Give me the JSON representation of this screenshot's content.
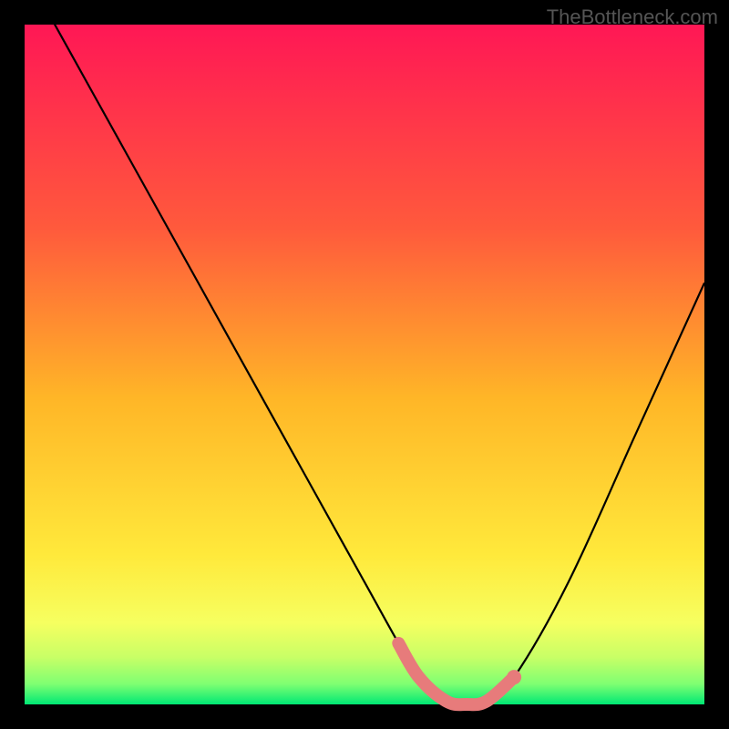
{
  "watermark": "TheBottleneck.com",
  "chart_data": {
    "type": "line",
    "title": "",
    "xlabel": "",
    "ylabel": "",
    "xlim": [
      0,
      100
    ],
    "ylim": [
      0,
      100
    ],
    "series": [
      {
        "name": "bottleneck-curve",
        "description": "V-shaped bottleneck curve; minimum (best/green) near x≈62-68, rising toward both ends (worst/red).",
        "x": [
          0,
          10,
          20,
          30,
          40,
          50,
          55,
          58,
          62,
          65,
          68,
          72,
          80,
          90,
          100
        ],
        "values": [
          108,
          90,
          72,
          54,
          36,
          18,
          9,
          4,
          0.5,
          0,
          0.5,
          4,
          18,
          40,
          62
        ]
      }
    ],
    "highlight": {
      "name": "optimal-zone",
      "color": "#e77b7b",
      "x_range": [
        55,
        72
      ],
      "marker_x": 72,
      "marker_y": 4
    },
    "background": {
      "type": "vertical-gradient",
      "stops": [
        {
          "pos": 0.0,
          "color": "#ff1755"
        },
        {
          "pos": 0.3,
          "color": "#ff5a3c"
        },
        {
          "pos": 0.55,
          "color": "#ffb627"
        },
        {
          "pos": 0.78,
          "color": "#ffe93b"
        },
        {
          "pos": 0.88,
          "color": "#f6ff60"
        },
        {
          "pos": 0.93,
          "color": "#c9ff66"
        },
        {
          "pos": 0.97,
          "color": "#7fff72"
        },
        {
          "pos": 1.0,
          "color": "#00e874"
        }
      ]
    }
  }
}
